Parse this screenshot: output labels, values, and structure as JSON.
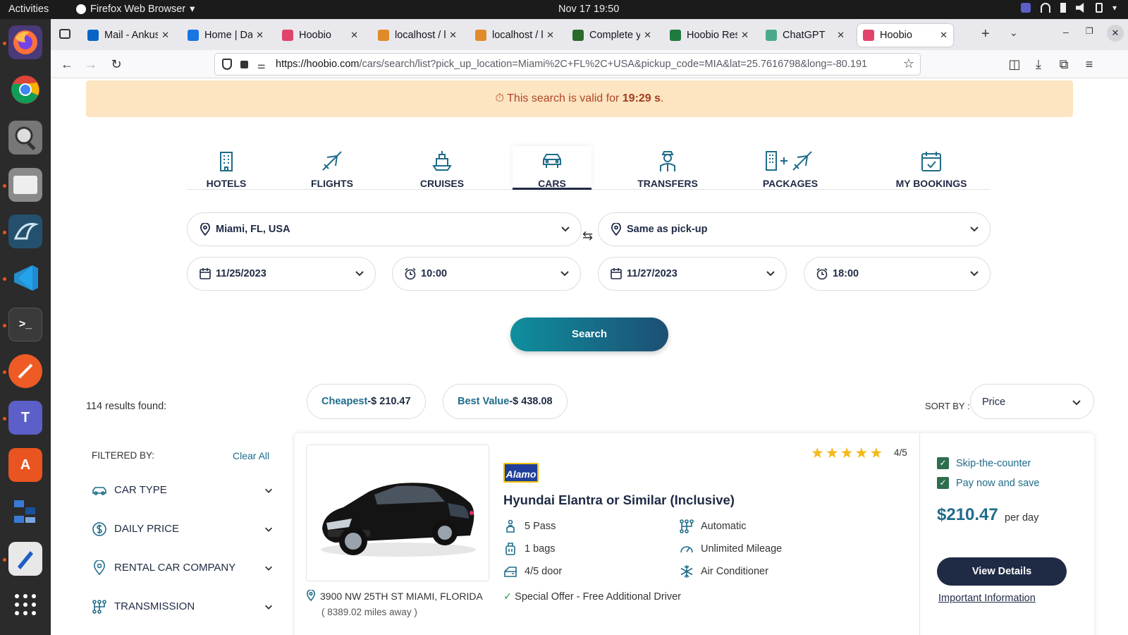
{
  "system": {
    "activities": "Activities",
    "app_name": "Firefox Web Browser",
    "clock": "Nov 17  19:50"
  },
  "dock": {
    "apps": [
      "firefox-icon",
      "chrome-icon",
      "screenshot-icon",
      "files-icon",
      "mysql-workbench-icon",
      "vscode-icon",
      "terminal-icon",
      "postman-icon",
      "teams-icon",
      "app-center-icon",
      "app-grid-icon",
      "text-editor-icon",
      "show-apps-icon"
    ]
  },
  "browser": {
    "tabs": [
      {
        "label": "Mail - Ankush",
        "color": "#0a64c8"
      },
      {
        "label": "Home | Dashb",
        "color": "#1b74e4"
      },
      {
        "label": "Hoobio",
        "color": "#e0436b"
      },
      {
        "label": "localhost / lo",
        "color": "#e08a2a"
      },
      {
        "label": "localhost / lo",
        "color": "#e08a2a"
      },
      {
        "label": "Complete yo",
        "color": "#2a6a2a"
      },
      {
        "label": "Hoobio Reso",
        "color": "#1f7a3f"
      },
      {
        "label": "ChatGPT",
        "color": "#4aa88c"
      },
      {
        "label": "Hoobio",
        "color": "#e0436b"
      }
    ],
    "url_host": "https://hoobio.com",
    "url_path": "/cars/search/list?pick_up_location=Miami%2C+FL%2C+USA&pickup_code=MIA&lat=25.7616798&long=-80.191"
  },
  "page": {
    "timer_prefix": "This search is valid for ",
    "timer_value": "19:29 s",
    "timer_suffix": ".",
    "services": [
      {
        "label": "HOTELS"
      },
      {
        "label": "FLIGHTS"
      },
      {
        "label": "CRUISES"
      },
      {
        "label": "CARS"
      },
      {
        "label": "TRANSFERS"
      },
      {
        "label": "PACKAGES"
      },
      {
        "label": "MY BOOKINGS"
      }
    ],
    "active_service": "CARS",
    "search": {
      "pickup_location": "Miami, FL, USA",
      "dropoff_location": "Same as pick-up",
      "pickup_date": "11/25/2023",
      "pickup_time": "10:00",
      "dropoff_date": "11/27/2023",
      "dropoff_time": "18:00",
      "button": "Search"
    },
    "results": {
      "count_text": "114 results found:",
      "cheapest_label": "Cheapest",
      "cheapest_value": " -$ 210.47",
      "best_label": "Best Value",
      "best_value": " -$ 438.08",
      "sort_label": "SORT BY :",
      "sort_value": "Price"
    },
    "filters": {
      "heading": "FILTERED BY:",
      "clear": "Clear All",
      "items": [
        "CAR TYPE",
        "DAILY PRICE",
        "RENTAL CAR COMPANY",
        "TRANSMISSION"
      ]
    },
    "card": {
      "vendor": "Alamo",
      "title": "Hyundai Elantra or Similar (Inclusive)",
      "specs": {
        "passengers": "5 Pass",
        "bags": "1 bags",
        "doors": "4/5 door",
        "transmission": "Automatic",
        "mileage": "Unlimited Mileage",
        "ac": "Air Conditioner"
      },
      "offer": "Special Offer - Free Additional Driver",
      "rating_stars": 5,
      "rating_text": "4/5",
      "address": "3900 NW 25TH ST MIAMI, FLORIDA",
      "distance": "( 8389.02 miles away )",
      "perks": [
        "Skip-the-counter",
        "Pay now and save"
      ],
      "price": "$210.47",
      "per_day": "per day",
      "details_button": "View Details",
      "important_info": "Important Information"
    }
  }
}
